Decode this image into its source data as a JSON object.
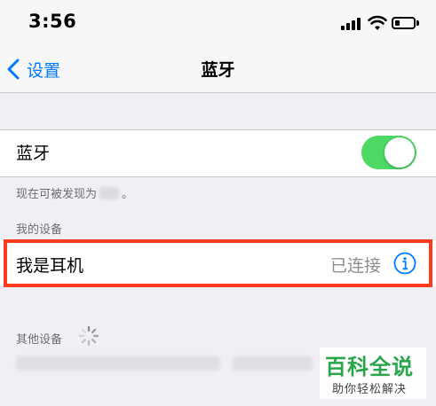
{
  "status_bar": {
    "time": "3:56"
  },
  "nav": {
    "back_label": "设置",
    "title": "蓝牙"
  },
  "bluetooth": {
    "label": "蓝牙",
    "toggle_on": true,
    "discoverable_prefix": "现在可被发现为",
    "discoverable_suffix": "。"
  },
  "sections": {
    "my_devices": "我的设备",
    "other_devices": "其他设备"
  },
  "my_device": {
    "name": "我是耳机",
    "status": "已连接"
  },
  "colors": {
    "accent": "#007aff",
    "toggle": "#4cd964",
    "highlight": "#ff3a1e",
    "watermark": "#2aa54b"
  },
  "watermark": {
    "main": "百科全说",
    "sub": "助你轻松解决"
  }
}
